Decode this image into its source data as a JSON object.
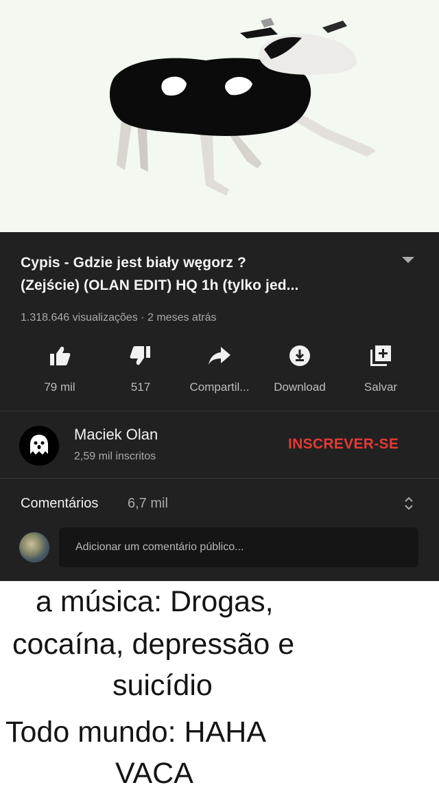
{
  "video": {
    "title_line1": "Cypis - Gdzie jest biały węgorz ?",
    "title_line2": "(Zejście) (OLAN EDIT) HQ 1h (tylko jed...",
    "meta": "1.318.646 visualizações · 2 meses atrás"
  },
  "actions": [
    {
      "icon": "thumbs-up-icon",
      "label": "79 mil"
    },
    {
      "icon": "thumbs-down-icon",
      "label": "517"
    },
    {
      "icon": "share-icon",
      "label": "Compartil..."
    },
    {
      "icon": "download-icon",
      "label": "Download"
    },
    {
      "icon": "save-playlist-icon",
      "label": "Salvar"
    }
  ],
  "channel": {
    "name": "Maciek Olan",
    "subscribers": "2,59 mil inscritos",
    "subscribe_label": "INSCREVER-SE"
  },
  "comments": {
    "label": "Comentários",
    "count": "6,7 mil",
    "placeholder": "Adicionar um comentário público..."
  },
  "caption": {
    "line1": "a música: Drogas,",
    "line2": "cocaína, depressão e",
    "line3": "suicídio",
    "line4": "Todo mundo: HAHA",
    "line5": "VACA"
  },
  "colors": {
    "panel_bg": "#212121",
    "subscribe_red": "#e53935",
    "muted_text": "#aaaaaa"
  }
}
